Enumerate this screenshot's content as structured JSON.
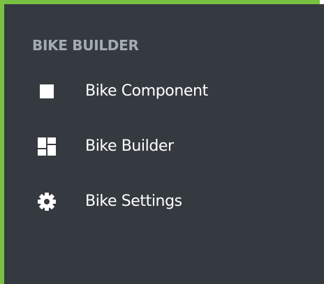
{
  "sidebar": {
    "heading": "BIKE BUILDER",
    "items": [
      {
        "label": "Bike Component",
        "icon": "square-icon"
      },
      {
        "label": "Bike Builder",
        "icon": "dashboard-icon"
      },
      {
        "label": "Bike Settings",
        "icon": "gear-icon"
      }
    ]
  },
  "colors": {
    "border_accent": "#7ac143",
    "panel_background": "#353a40",
    "heading_text": "#a3abb3",
    "item_text": "#ffffff"
  }
}
